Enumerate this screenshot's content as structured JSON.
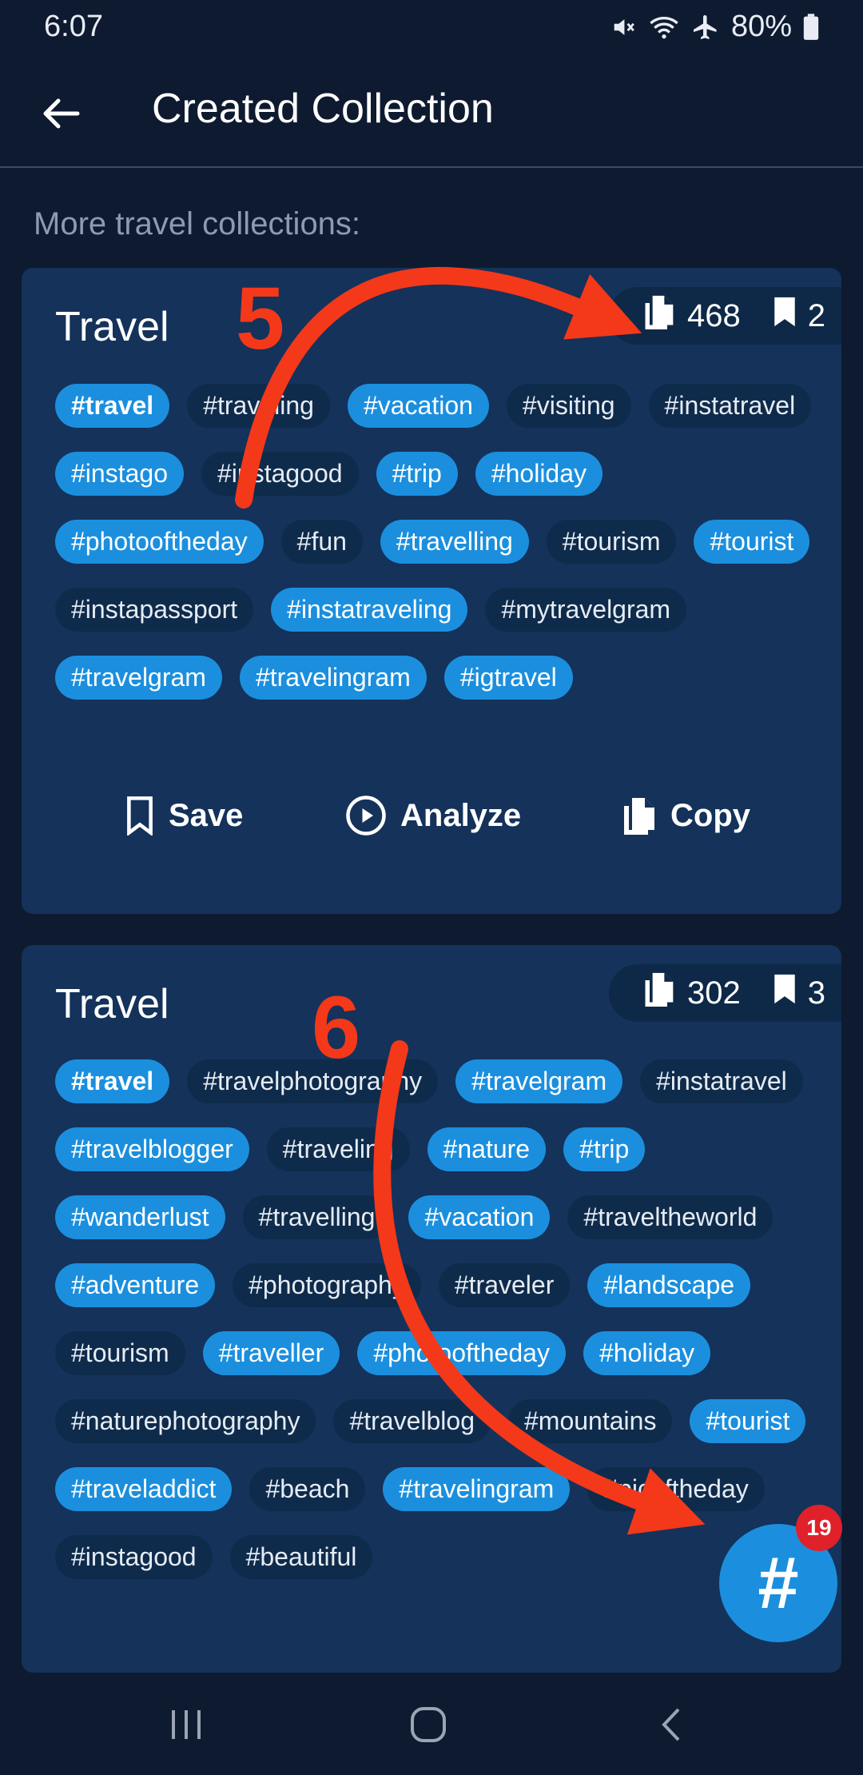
{
  "status": {
    "time": "6:07",
    "battery": "80%"
  },
  "header": {
    "title": "Created Collection"
  },
  "section_label": "More travel collections:",
  "cards": [
    {
      "title": "Travel",
      "copies": "468",
      "saves": "2",
      "tags": [
        {
          "text": "#travel",
          "hl": true,
          "bold": true
        },
        {
          "text": "#traveling",
          "hl": false
        },
        {
          "text": "#vacation",
          "hl": true
        },
        {
          "text": "#visiting",
          "hl": false
        },
        {
          "text": "#instatravel",
          "hl": false
        },
        {
          "text": "#instago",
          "hl": true
        },
        {
          "text": "#instagood",
          "hl": false
        },
        {
          "text": "#trip",
          "hl": true
        },
        {
          "text": "#holiday",
          "hl": true
        },
        {
          "text": "#photooftheday",
          "hl": true
        },
        {
          "text": "#fun",
          "hl": false
        },
        {
          "text": "#travelling",
          "hl": true
        },
        {
          "text": "#tourism",
          "hl": false
        },
        {
          "text": "#tourist",
          "hl": true
        },
        {
          "text": "#instapassport",
          "hl": false
        },
        {
          "text": "#instatraveling",
          "hl": true
        },
        {
          "text": "#mytravelgram",
          "hl": false
        },
        {
          "text": "#travelgram",
          "hl": true
        },
        {
          "text": "#travelingram",
          "hl": true
        },
        {
          "text": "#igtravel",
          "hl": true
        }
      ],
      "actions": {
        "save": "Save",
        "analyze": "Analyze",
        "copy": "Copy"
      }
    },
    {
      "title": "Travel",
      "copies": "302",
      "saves": "3",
      "tags": [
        {
          "text": "#travel",
          "hl": true,
          "bold": true
        },
        {
          "text": "#travelphotography",
          "hl": false
        },
        {
          "text": "#travelgram",
          "hl": true
        },
        {
          "text": "#instatravel",
          "hl": false
        },
        {
          "text": "#travelblogger",
          "hl": true
        },
        {
          "text": "#traveling",
          "hl": false
        },
        {
          "text": "#nature",
          "hl": true
        },
        {
          "text": "#trip",
          "hl": true
        },
        {
          "text": "#wanderlust",
          "hl": true
        },
        {
          "text": "#travelling",
          "hl": false
        },
        {
          "text": "#vacation",
          "hl": true
        },
        {
          "text": "#traveltheworld",
          "hl": false
        },
        {
          "text": "#adventure",
          "hl": true
        },
        {
          "text": "#photography",
          "hl": false
        },
        {
          "text": "#traveler",
          "hl": false
        },
        {
          "text": "#landscape",
          "hl": true
        },
        {
          "text": "#tourism",
          "hl": false
        },
        {
          "text": "#traveller",
          "hl": true
        },
        {
          "text": "#photooftheday",
          "hl": true
        },
        {
          "text": "#holiday",
          "hl": true
        },
        {
          "text": "#naturephotography",
          "hl": false
        },
        {
          "text": "#travelblog",
          "hl": false
        },
        {
          "text": "#mountains",
          "hl": false
        },
        {
          "text": "#tourist",
          "hl": true
        },
        {
          "text": "#traveladdict",
          "hl": true
        },
        {
          "text": "#beach",
          "hl": false
        },
        {
          "text": "#travelingram",
          "hl": true
        },
        {
          "text": "#picoftheday",
          "hl": false
        },
        {
          "text": "#instagood",
          "hl": false
        },
        {
          "text": "#beautiful",
          "hl": false
        }
      ]
    }
  ],
  "fab": {
    "label": "#",
    "badge": "19"
  },
  "annotations": {
    "step_a": "5",
    "step_b": "6",
    "color": "#f4381a"
  },
  "colors": {
    "background": "#0e1a30",
    "card": "#14325a",
    "tag_highlight": "#1b8fde",
    "tag_plain": "#0f2b4b",
    "badge": "#e0212a"
  }
}
